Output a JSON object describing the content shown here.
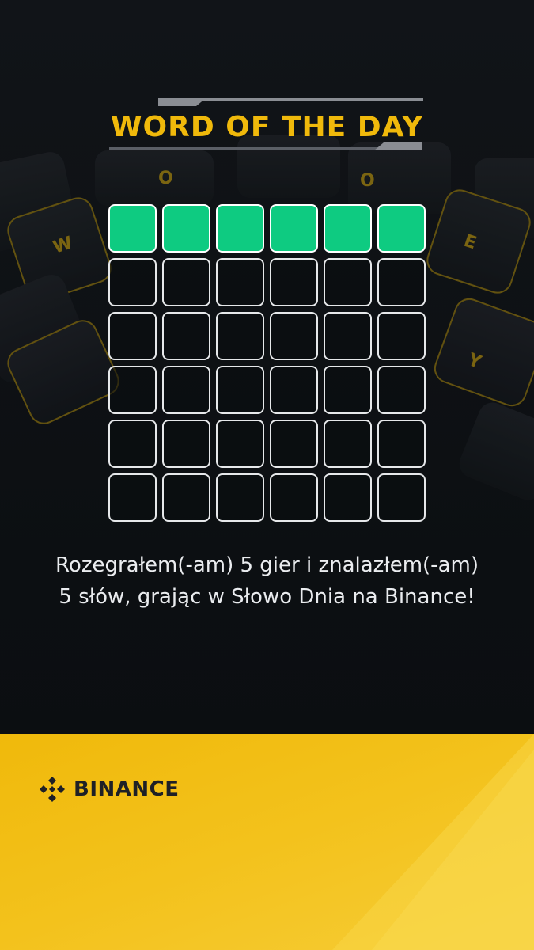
{
  "title": "WORD OF THE DAY",
  "grid": {
    "rows": 6,
    "cols": 6,
    "row_states": [
      "correct",
      "empty",
      "empty",
      "empty",
      "empty",
      "empty"
    ]
  },
  "message": "Rozegrałem(-am) 5 gier i znalazłem(-am) 5 słów, grając w Słowo Dnia na Binance!",
  "brand": {
    "name": "BINANCE",
    "logo_icon": "binance-diamond-icon"
  },
  "backdrop": {
    "key_letters": [
      "W",
      "O",
      "O",
      "E",
      "Y"
    ]
  },
  "colors": {
    "accent": "#f0b90b",
    "correct": "#0ecb81",
    "background": "#0b0e11",
    "footer": "#f0b90b",
    "text": "#eaecef"
  }
}
